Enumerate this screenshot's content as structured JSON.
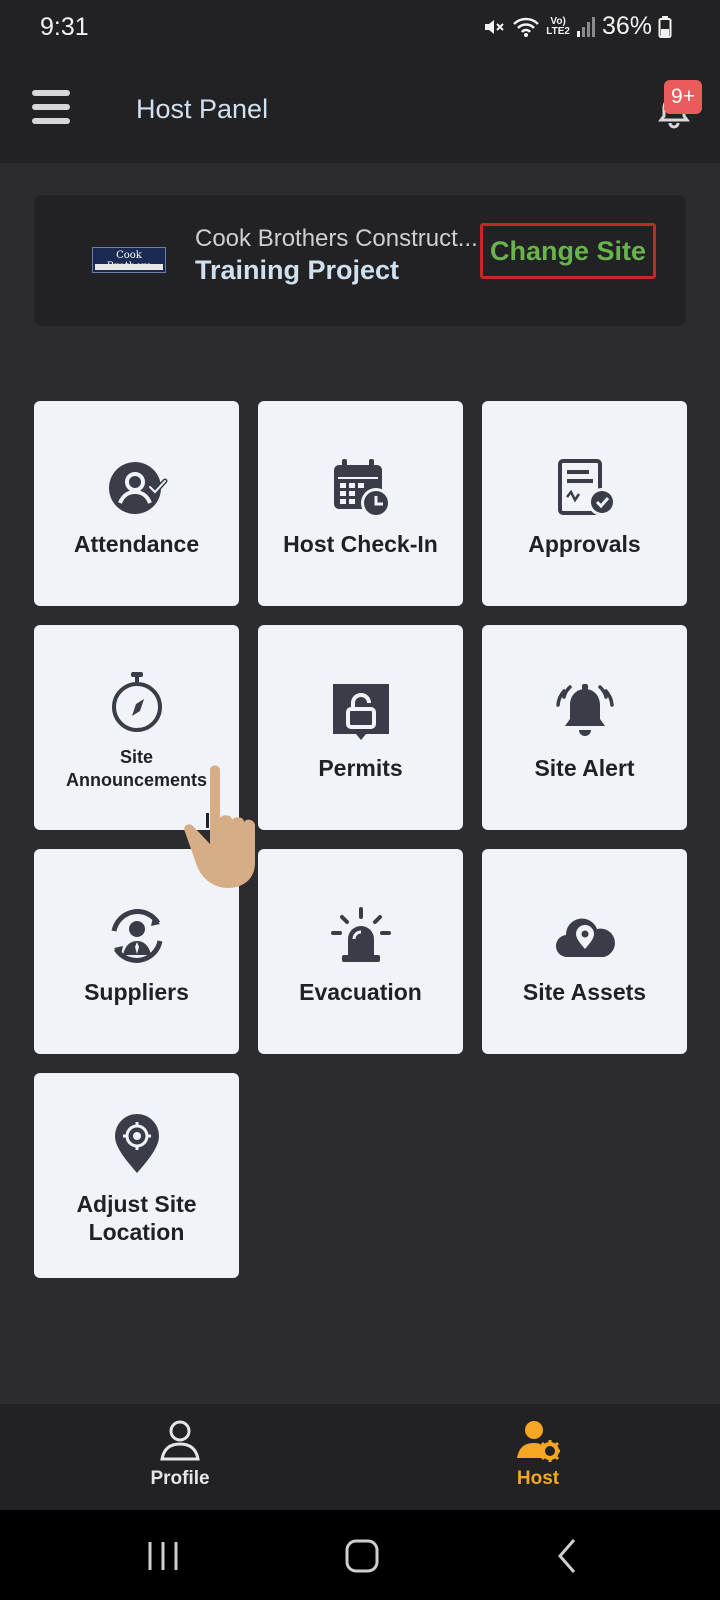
{
  "status_bar": {
    "time": "9:31",
    "battery": "36%",
    "network_top": "Vo)",
    "network_bottom": "LTE2"
  },
  "app_bar": {
    "title": "Host Panel",
    "notification_badge": "9+"
  },
  "site_card": {
    "company": "Cook Brothers Construct...",
    "project": "Training Project",
    "change_site_label": "Change Site",
    "logo_text": "Cook Brothers"
  },
  "tiles": [
    {
      "label": "Attendance",
      "icon": "attendance-icon"
    },
    {
      "label": "Host Check-In",
      "icon": "calendar-clock-icon"
    },
    {
      "label": "Approvals",
      "icon": "approval-document-icon"
    },
    {
      "label": "Site\nAnnouncements",
      "icon": "stopwatch-compass-icon"
    },
    {
      "label": "Permits",
      "icon": "padlock-icon"
    },
    {
      "label": "Site Alert",
      "icon": "alarm-bell-icon"
    },
    {
      "label": "Suppliers",
      "icon": "supplier-cycle-icon"
    },
    {
      "label": "Evacuation",
      "icon": "siren-icon"
    },
    {
      "label": "Site Assets",
      "icon": "cloud-pin-icon"
    },
    {
      "label": "Adjust Site\nLocation",
      "icon": "location-pin-icon"
    }
  ],
  "bottom_nav": {
    "profile_label": "Profile",
    "host_label": "Host",
    "active_color": "#f5a623",
    "inactive_color": "#e6e6e6"
  },
  "colors": {
    "change_site_border": "#c62828",
    "change_site_text": "#69b34c",
    "badge": "#ea5b5b"
  }
}
